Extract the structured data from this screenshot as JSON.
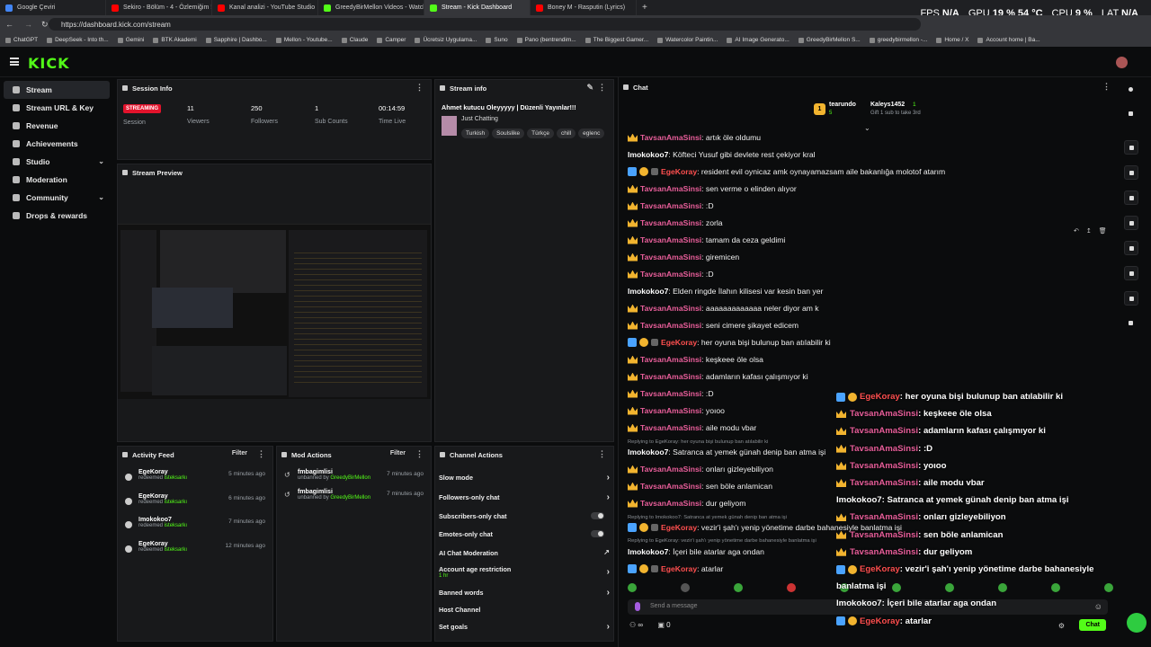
{
  "browser": {
    "tabs": [
      {
        "title": "Google Çeviri",
        "color": "#4285f4",
        "active": false
      },
      {
        "title": "Sekiro - Bölüm - 4 - Özlemiğim !!!",
        "color": "#ff0000",
        "active": false
      },
      {
        "title": "Kanal analizi - YouTube Studio",
        "color": "#ff0000",
        "active": false
      },
      {
        "title": "GreedyBirMellon Videos - Watch C",
        "color": "#53fc18",
        "active": false
      },
      {
        "title": "Stream - Kick Dashboard",
        "color": "#53fc18",
        "active": true
      },
      {
        "title": "Boney M - Rasputin (Lyrics)",
        "color": "#ff0000",
        "active": false
      }
    ],
    "url": "https://dashboard.kick.com/stream",
    "bookmarks": [
      "ChatGPT",
      "DeepSeek - Into th...",
      "Gemini",
      "BTK Akademi",
      "Sapphire | Dashbo...",
      "Mellon - Youtube...",
      "Claude",
      "Camper",
      "Ücretsiz Uygulama...",
      "Suno",
      "Pano (bentrendim...",
      "The Biggest Gamer...",
      "Watercolor Paintin...",
      "AI Image Generato...",
      "GreedyBirMellon S...",
      "greedybirmellon -...",
      "Home / X",
      "Account home | Ba..."
    ]
  },
  "stats": {
    "fps_label": "FPS",
    "fps": "N/A",
    "gpu_label": "GPU",
    "gpu": "19 % 54 °C",
    "cpu_label": "CPU",
    "cpu": "9 %",
    "lat_label": "LAT",
    "lat": "N/A"
  },
  "app": {
    "logo": "KICK"
  },
  "sidebar": {
    "items": [
      {
        "label": "Stream"
      },
      {
        "label": "Stream URL & Key"
      },
      {
        "label": "Revenue"
      },
      {
        "label": "Achievements"
      },
      {
        "label": "Studio"
      },
      {
        "label": "Moderation"
      },
      {
        "label": "Community"
      },
      {
        "label": "Drops & rewards"
      }
    ]
  },
  "session": {
    "title": "Session Info",
    "badge": "STREAMING",
    "session_label": "Session",
    "viewers": "11",
    "viewers_label": "Viewers",
    "followers": "250",
    "followers_label": "Followers",
    "subs": "1",
    "subs_label": "Sub Counts",
    "time": "00:14:59",
    "time_label": "Time Live"
  },
  "preview": {
    "title": "Stream Preview"
  },
  "streaminfo": {
    "title": "Stream info",
    "stream_title": "Ahmet kutucu Oleyyyyy | Düzenli Yayınlar!!!",
    "category": "Just Chatting",
    "tags": [
      "Turkish",
      "Soulslike",
      "Türkçe",
      "chill",
      "eglenc"
    ]
  },
  "activity": {
    "title": "Activity Feed",
    "filter": "Filter",
    "items": [
      {
        "user": "EgeKoray",
        "action": "redeemed",
        "reward": "isteksarkı",
        "time": "5 minutes ago"
      },
      {
        "user": "EgeKoray",
        "action": "redeemed",
        "reward": "isteksarkı",
        "time": "6 minutes ago"
      },
      {
        "user": "Imokokoo7",
        "action": "redeemed",
        "reward": "isteksarkı",
        "time": "7 minutes ago"
      },
      {
        "user": "EgeKoray",
        "action": "redeemed",
        "reward": "isteksarkı",
        "time": "12 minutes ago"
      }
    ]
  },
  "modactions": {
    "title": "Mod Actions",
    "filter": "Filter",
    "items": [
      {
        "user": "fmbagimlisi",
        "action": "unbanned by",
        "by": "GreedyBirMellon",
        "time": "7 minutes ago"
      },
      {
        "user": "fmbagimlisi",
        "action": "unbanned by",
        "by": "GreedyBirMellon",
        "time": "7 minutes ago"
      }
    ]
  },
  "channelactions": {
    "title": "Channel Actions",
    "slow": "Slow mode",
    "followers": "Followers-only chat",
    "subscribers": "Subscribers-only chat",
    "emotes": "Emotes-only chat",
    "ai": "AI Chat Moderation",
    "age": "Account age restriction",
    "age_value": "1 hr",
    "banned": "Banned words",
    "host": "Host Channel",
    "goals": "Set goals"
  },
  "chat": {
    "title": "Chat",
    "top_user": "tearundo",
    "top_rank": "1",
    "top_count": "5",
    "gifter": "Kaleys1452",
    "gifter_count": "1",
    "gift_text": "Gift 1 sub to take 3rd",
    "placeholder": "Send a message",
    "send": "Chat",
    "infinite": "∞",
    "count": "0",
    "messages": [
      {
        "b": "crown",
        "u": "TavsanAmaSinsi",
        "c": "pink",
        "t": ": artık öle oldumu"
      },
      {
        "b": "",
        "u": "Imokokoo7",
        "c": "white",
        "t": ": Köfteci Yusuf gibi devlete rest çekiyor kral"
      },
      {
        "b": "mod",
        "u": "EgeKoray",
        "c": "red",
        "t": ": resident evil oynicaz amk oynayamazsam aile bakanlığa molotof atarım"
      },
      {
        "b": "crown",
        "u": "TavsanAmaSinsi",
        "c": "pink",
        "t": ": sen verme o elinden alıyor"
      },
      {
        "b": "crown",
        "u": "TavsanAmaSinsi",
        "c": "pink",
        "t": ": :D"
      },
      {
        "b": "crown",
        "u": "TavsanAmaSinsi",
        "c": "pink",
        "t": ": zorla"
      },
      {
        "b": "crown",
        "u": "TavsanAmaSinsi",
        "c": "pink",
        "t": ": tamam da ceza geldimi"
      },
      {
        "b": "crown",
        "u": "TavsanAmaSinsi",
        "c": "pink",
        "t": ": giremicen"
      },
      {
        "b": "crown",
        "u": "TavsanAmaSinsi",
        "c": "pink",
        "t": ": :D"
      },
      {
        "b": "",
        "u": "Imokokoo7",
        "c": "white",
        "t": ": Elden ringde İlahın kilisesi var kesin ban yer"
      },
      {
        "b": "crown",
        "u": "TavsanAmaSinsi",
        "c": "pink",
        "t": ": aaaaaaaaaaaaa neler diyor am k"
      },
      {
        "b": "crown",
        "u": "TavsanAmaSinsi",
        "c": "pink",
        "t": ": seni cimere şikayet edicem"
      },
      {
        "b": "mod",
        "u": "EgeKoray",
        "c": "red",
        "t": ": her oyuna bişi bulunup ban atılabilir ki"
      },
      {
        "b": "crown",
        "u": "TavsanAmaSinsi",
        "c": "pink",
        "t": ": keşkeee öle olsa"
      },
      {
        "b": "crown",
        "u": "TavsanAmaSinsi",
        "c": "pink",
        "t": ": adamların kafası çalışmıyor ki"
      },
      {
        "b": "crown",
        "u": "TavsanAmaSinsi",
        "c": "pink",
        "t": ": :D"
      },
      {
        "b": "crown",
        "u": "TavsanAmaSinsi",
        "c": "pink",
        "t": ": yoıoo"
      },
      {
        "b": "crown",
        "u": "TavsanAmaSinsi",
        "c": "pink",
        "t": ": aile modu vbar"
      }
    ],
    "reply1": "Replying to EgeKoray: her oyuna bişi bulunup ban atılabilir ki",
    "messages2": [
      {
        "b": "",
        "u": "Imokokoo7",
        "c": "white",
        "t": ": Satranca at yemek günah denip ban atma işi"
      },
      {
        "b": "crown",
        "u": "TavsanAmaSinsi",
        "c": "pink",
        "t": ": onları gizleyebiliyon"
      },
      {
        "b": "crown",
        "u": "TavsanAmaSinsi",
        "c": "pink",
        "t": ": sen böle anlamican"
      },
      {
        "b": "crown",
        "u": "TavsanAmaSinsi",
        "c": "pink",
        "t": ": dur geliyom"
      }
    ],
    "reply2": "Replying to Imokokoo7: Satranca at yemek günah denip ban atma işi",
    "msg_vezir": {
      "b": "mod",
      "u": "EgeKoray",
      "c": "red",
      "t": ": vezir'i şah'ı yenip yönetime darbe bahanesiyle banlatma işi"
    },
    "reply3": "Replying to EgeKoray: vezir'i şah'ı yenip yönetime darbe bahanesiyle banlatma işi",
    "msg_iceri": {
      "b": "",
      "u": "Imokokoo7",
      "c": "white",
      "t": ": İçeri bile atarlar aga ondan"
    },
    "msg_atarlar": {
      "b": "mod",
      "u": "EgeKoray",
      "c": "red",
      "t": ": atarlar"
    }
  },
  "overlay": [
    {
      "b": "mod",
      "u": "EgeKoray",
      "c": "red",
      "t": ": her oyuna bişi bulunup ban atılabilir ki"
    },
    {
      "b": "crown",
      "u": "TavsanAmaSinsi",
      "c": "pink",
      "t": ": keşkeee öle olsa"
    },
    {
      "b": "crown",
      "u": "TavsanAmaSinsi",
      "c": "pink",
      "t": ": adamların kafası çalışmıyor ki"
    },
    {
      "b": "crown",
      "u": "TavsanAmaSinsi",
      "c": "pink",
      "t": ": :D"
    },
    {
      "b": "crown",
      "u": "TavsanAmaSinsi",
      "c": "pink",
      "t": ": yoıoo"
    },
    {
      "b": "crown",
      "u": "TavsanAmaSinsi",
      "c": "pink",
      "t": ": aile modu vbar"
    },
    {
      "b": "",
      "u": "Imokokoo7",
      "c": "white",
      "t": ": Satranca at yemek günah denip ban atma işi"
    },
    {
      "b": "crown",
      "u": "TavsanAmaSinsi",
      "c": "pink",
      "t": ": onları gizleyebiliyon"
    },
    {
      "b": "crown",
      "u": "TavsanAmaSinsi",
      "c": "pink",
      "t": ": sen böle anlamican"
    },
    {
      "b": "crown",
      "u": "TavsanAmaSinsi",
      "c": "pink",
      "t": ": dur geliyom"
    },
    {
      "b": "mod",
      "u": "EgeKoray",
      "c": "red",
      "t": ": vezir'i şah'ı yenip yönetime darbe bahanesiyle"
    },
    {
      "b": "",
      "u": "",
      "c": "white",
      "t": "banlatma işi"
    },
    {
      "b": "",
      "u": "Imokokoo7",
      "c": "white",
      "t": ": İçeri bile atarlar aga ondan"
    },
    {
      "b": "mod",
      "u": "EgeKoray",
      "c": "red",
      "t": ": atarlar"
    }
  ]
}
